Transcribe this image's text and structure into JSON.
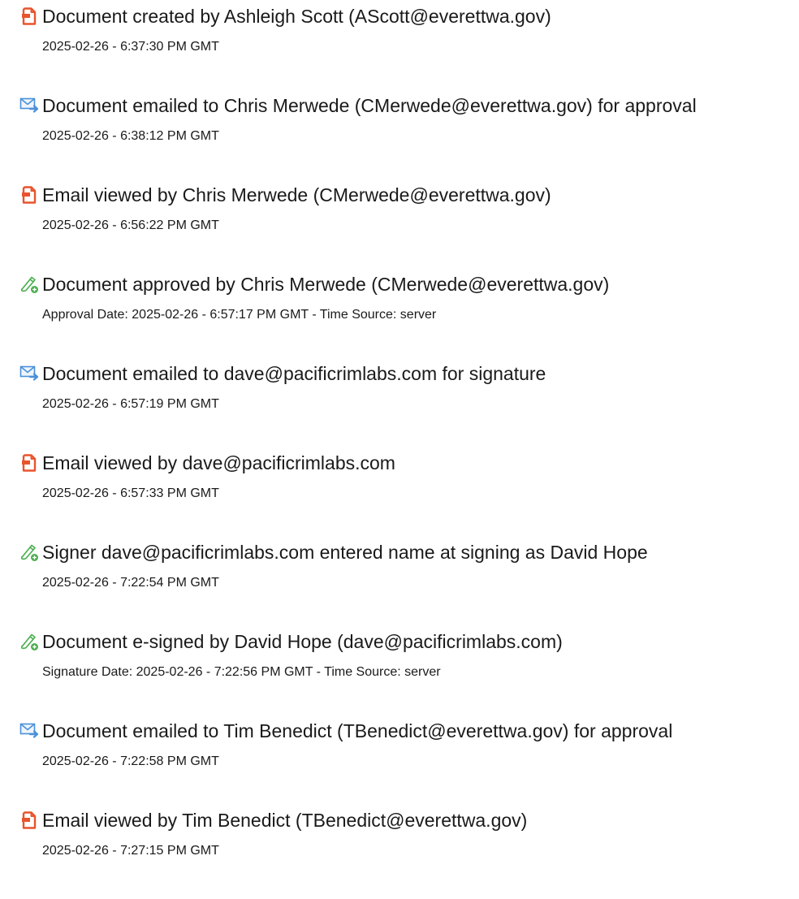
{
  "events": [
    {
      "icon": "document-icon",
      "title": "Document created by Ashleigh Scott (AScott@everettwa.gov)",
      "detail": "2025-02-26 - 6:37:30 PM GMT"
    },
    {
      "icon": "email-sent-icon",
      "title": "Document emailed to Chris Merwede (CMerwede@everettwa.gov) for approval",
      "detail": "2025-02-26 - 6:38:12 PM GMT"
    },
    {
      "icon": "document-icon",
      "title": "Email viewed by Chris Merwede (CMerwede@everettwa.gov)",
      "detail": "2025-02-26 - 6:56:22 PM GMT"
    },
    {
      "icon": "pen-sign-icon",
      "title": "Document approved by Chris Merwede (CMerwede@everettwa.gov)",
      "detail": "Approval Date: 2025-02-26 - 6:57:17 PM GMT - Time Source: server"
    },
    {
      "icon": "email-sent-icon",
      "title": "Document emailed to dave@pacificrimlabs.com for signature",
      "detail": "2025-02-26 - 6:57:19 PM GMT"
    },
    {
      "icon": "document-icon",
      "title": "Email viewed by dave@pacificrimlabs.com",
      "detail": "2025-02-26 - 6:57:33 PM GMT"
    },
    {
      "icon": "pen-sign-icon",
      "title": "Signer dave@pacificrimlabs.com entered name at signing as David Hope",
      "detail": "2025-02-26 - 7:22:54 PM GMT"
    },
    {
      "icon": "pen-sign-icon",
      "title": "Document e-signed by David Hope (dave@pacificrimlabs.com)",
      "detail": "Signature Date: 2025-02-26 - 7:22:56 PM GMT - Time Source: server"
    },
    {
      "icon": "email-sent-icon",
      "title": "Document emailed to Tim Benedict (TBenedict@everettwa.gov) for approval",
      "detail": "2025-02-26 - 7:22:58 PM GMT"
    },
    {
      "icon": "document-icon",
      "title": "Email viewed by Tim Benedict (TBenedict@everettwa.gov)",
      "detail": "2025-02-26 - 7:27:15 PM GMT"
    }
  ],
  "colors": {
    "document_icon": "#e8542c",
    "email_icon": "#4a90d9",
    "pen_icon": "#4caf50",
    "text": "#1a1a1a"
  }
}
